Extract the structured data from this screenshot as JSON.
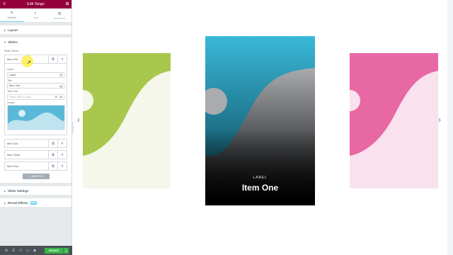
{
  "app": {
    "title": "Edit Tango"
  },
  "tabs": [
    {
      "label": "Content",
      "icon": "pencil-icon"
    },
    {
      "label": "Style",
      "icon": "half-circle-icon"
    },
    {
      "label": "Advanced",
      "icon": "gear-icon"
    }
  ],
  "sections": {
    "layout": "Layout",
    "sliders": "Sliders",
    "slider_settings": "Slider Settings",
    "reveal_effects": "Reveal Effects",
    "pro_badge": "PRO"
  },
  "slider_items": {
    "label": "Slider Items",
    "items": [
      {
        "title": "Item One"
      },
      {
        "title": "Item Two"
      },
      {
        "title": "Item Three"
      },
      {
        "title": "Item Four"
      }
    ],
    "expanded": {
      "label_field_label": "Label",
      "label_value": "Label",
      "title_field_label": "Title",
      "title_value": "Item One",
      "title_link_label": "Title Link",
      "title_link_placeholder": "Paste URL or type",
      "image_label": "Image"
    },
    "add_button": "ADD ITEM"
  },
  "footer": {
    "update_label": "UPDATE"
  },
  "slider": {
    "center": {
      "label": "LABEL",
      "title": "Item One"
    },
    "colors": {
      "green": "#a9c74c",
      "pink": "#e868a4",
      "teal": "#3ab9d9",
      "accent": "#93003c",
      "update": "#39b54a"
    }
  }
}
